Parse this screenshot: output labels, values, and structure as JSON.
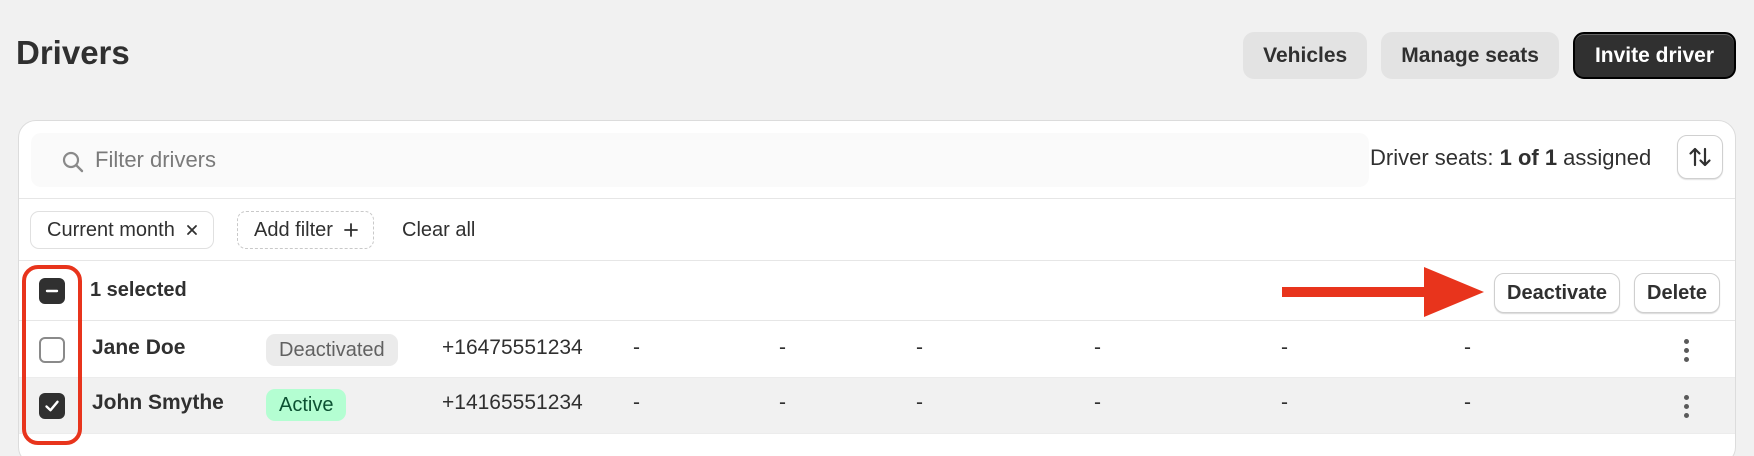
{
  "page": {
    "title": "Drivers"
  },
  "header_actions": {
    "vehicles_label": "Vehicles",
    "manage_seats_label": "Manage seats",
    "invite_label": "Invite driver"
  },
  "toolbar": {
    "search_placeholder": "Filter drivers",
    "search_value": "",
    "seats_prefix": "Driver seats: ",
    "seats_count": "1 of 1",
    "seats_suffix": " assigned"
  },
  "filters": {
    "applied": "Current month",
    "add_label": "Add filter",
    "clear_label": "Clear all"
  },
  "bulk": {
    "selected_text": "1 selected",
    "deactivate_label": "Deactivate",
    "delete_label": "Delete"
  },
  "rows": [
    {
      "name": "Jane Doe",
      "status": "Deactivated",
      "phone": "+16475551234",
      "c1": "-",
      "c2": "-",
      "c3": "-",
      "c4": "-",
      "c5": "-",
      "c6": "-",
      "checked": false
    },
    {
      "name": "John Smythe",
      "status": "Active",
      "phone": "+14165551234",
      "c1": "-",
      "c2": "-",
      "c3": "-",
      "c4": "-",
      "c5": "-",
      "c6": "-",
      "checked": true
    }
  ],
  "icons": {
    "search": "search-icon",
    "sort": "sort-arrows-icon",
    "remove": "close-icon",
    "add": "plus-icon",
    "more": "more-vertical-icon",
    "check": "checkmark-icon",
    "indeterminate": "minus-icon"
  },
  "colors": {
    "primary": "#303030",
    "active_badge_bg": "#b4fed2",
    "active_badge_text": "#0c5132",
    "annotation": "#e8341c"
  }
}
